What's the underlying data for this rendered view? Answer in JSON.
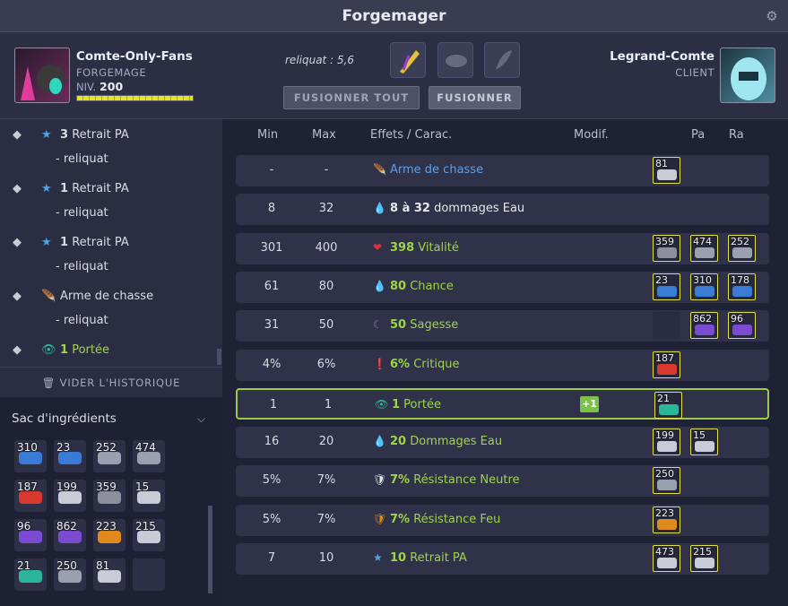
{
  "title": "Forgemager",
  "left_player": {
    "name": "Comte-Only-Fans",
    "role": "FORGEMAGE",
    "level_label": "NIV.",
    "level": "200",
    "xp_fraction": 1.0
  },
  "right_player": {
    "name": "Legrand-Comte",
    "role": "CLIENT"
  },
  "reliquat": "reliquat : 5,6",
  "buttons": {
    "fuse_all": "FUSIONNER TOUT",
    "fuse": "FUSIONNER"
  },
  "history": [
    {
      "count": "3",
      "text": "Retrait PA",
      "sub": "- reliquat",
      "icon": "pa-star-icon"
    },
    {
      "count": "1",
      "text": "Retrait PA",
      "sub": "- reliquat",
      "icon": "pa-star-icon"
    },
    {
      "count": "1",
      "text": "Retrait PA",
      "sub": "- reliquat",
      "icon": "pa-star-icon"
    },
    {
      "count": "",
      "text": "Arme de chasse",
      "sub": "- reliquat",
      "icon": "feather-icon"
    },
    {
      "count": "1",
      "text": "Portée",
      "sub": "",
      "icon": "eye-icon"
    }
  ],
  "clear_history": "VIDER L'HISTORIQUE",
  "bag_title": "Sac d'ingrédients",
  "bag": [
    {
      "q": "310",
      "color": "#3a7bd5"
    },
    {
      "q": "23",
      "color": "#3a7bd5"
    },
    {
      "q": "252",
      "color": "#9aa0b0"
    },
    {
      "q": "474",
      "color": "#9aa0b0"
    },
    {
      "q": "187",
      "color": "#d8382f"
    },
    {
      "q": "199",
      "color": "#c9ccd6"
    },
    {
      "q": "359",
      "color": "#8c8f9c"
    },
    {
      "q": "15",
      "color": "#c9ccd6"
    },
    {
      "q": "96",
      "color": "#7a4ad0"
    },
    {
      "q": "862",
      "color": "#7a4ad0"
    },
    {
      "q": "223",
      "color": "#e08a1e"
    },
    {
      "q": "215",
      "color": "#c9ccd6"
    },
    {
      "q": "21",
      "color": "#2bb59c"
    },
    {
      "q": "250",
      "color": "#9aa0b0"
    },
    {
      "q": "81",
      "color": "#c9ccd6"
    },
    {
      "q": "",
      "color": ""
    }
  ],
  "columns": {
    "min": "Min",
    "max": "Max",
    "effects": "Effets / Carac.",
    "modif": "Modif.",
    "pa": "Pa",
    "ra": "Ra"
  },
  "rows": [
    {
      "min": "-",
      "max": "-",
      "icon": "feather-icon",
      "icon_glyph": "🪶",
      "effect": "Arme de chasse",
      "style": "blue",
      "modif": "",
      "runes": [
        {
          "q": "81",
          "color": "#c9ccd6"
        }
      ]
    },
    {
      "min": "8",
      "max": "32",
      "icon": "water-drop-icon",
      "icon_glyph": "💧",
      "effect_bold": "8 à 32",
      "effect": " dommages Eau",
      "style": "white",
      "modif": "",
      "runes": []
    },
    {
      "min": "301",
      "max": "400",
      "icon": "heart-icon",
      "icon_glyph": "❤",
      "effect_bold": "398",
      "effect": " Vitalité",
      "style": "green",
      "modif": "",
      "runes": [
        {
          "q": "359",
          "color": "#8c8f9c"
        },
        {
          "q": "474",
          "color": "#9aa0b0"
        },
        {
          "q": "252",
          "color": "#9aa0b0"
        }
      ]
    },
    {
      "min": "61",
      "max": "80",
      "icon": "water-drop-icon",
      "icon_glyph": "💧",
      "effect_bold": "80",
      "effect": " Chance",
      "style": "green",
      "modif": "",
      "runes": [
        {
          "q": "23",
          "color": "#3a7bd5"
        },
        {
          "q": "310",
          "color": "#3a7bd5"
        },
        {
          "q": "178",
          "color": "#3a7bd5"
        }
      ]
    },
    {
      "min": "31",
      "max": "50",
      "icon": "moon-icon",
      "icon_glyph": "☾",
      "effect_bold": "50",
      "effect": " Sagesse",
      "style": "green",
      "modif": "",
      "runes": [
        {
          "q": "",
          "color": ""
        },
        {
          "q": "862",
          "color": "#7a4ad0"
        },
        {
          "q": "96",
          "color": "#7a4ad0"
        }
      ]
    },
    {
      "min": "4%",
      "max": "6%",
      "icon": "critical-icon",
      "icon_glyph": "❗",
      "effect_bold": "6%",
      "effect": " Critique",
      "style": "green",
      "modif": "",
      "runes": [
        {
          "q": "187",
          "color": "#d8382f"
        }
      ]
    },
    {
      "min": "1",
      "max": "1",
      "icon": "eye-icon",
      "icon_glyph": "👁",
      "effect_bold": "1",
      "effect": " Portée",
      "style": "green",
      "modif": "+1",
      "selected": true,
      "runes": [
        {
          "q": "21",
          "color": "#2bb59c"
        }
      ]
    },
    {
      "min": "16",
      "max": "20",
      "icon": "water-drop-icon",
      "icon_glyph": "💧",
      "effect_bold": "20",
      "effect": " Dommages Eau",
      "style": "green",
      "modif": "",
      "runes": [
        {
          "q": "199",
          "color": "#c9ccd6"
        },
        {
          "q": "15",
          "color": "#c9ccd6"
        }
      ]
    },
    {
      "min": "5%",
      "max": "7%",
      "icon": "shield-neutral-icon",
      "icon_glyph": "🛡",
      "effect_bold": "7%",
      "effect": " Résistance Neutre",
      "style": "green",
      "modif": "",
      "runes": [
        {
          "q": "250",
          "color": "#9aa0b0"
        }
      ]
    },
    {
      "min": "5%",
      "max": "7%",
      "icon": "shield-fire-icon",
      "icon_glyph": "🛡",
      "effect_bold": "7%",
      "effect": " Résistance Feu",
      "style": "green",
      "modif": "",
      "runes": [
        {
          "q": "223",
          "color": "#e08a1e"
        }
      ]
    },
    {
      "min": "7",
      "max": "10",
      "icon": "pa-star-icon",
      "icon_glyph": "★",
      "effect_bold": "10",
      "effect": " Retrait PA",
      "style": "green",
      "modif": "",
      "runes": [
        {
          "q": "473",
          "color": "#c9ccd6"
        },
        {
          "q": "215",
          "color": "#c9ccd6"
        }
      ]
    }
  ]
}
